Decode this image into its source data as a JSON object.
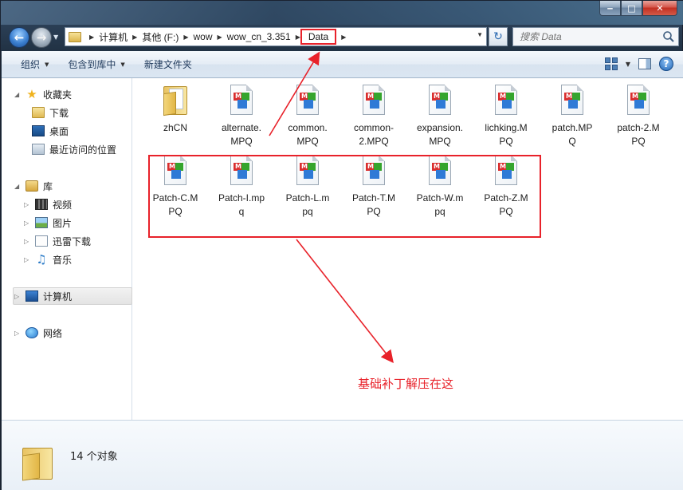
{
  "window": {
    "caption_minimize": "‒",
    "caption_maximize": "□",
    "caption_close": "✕"
  },
  "address_bar": {
    "crumbs": [
      "计算机",
      "其他 (F:)",
      "wow",
      "wow_cn_3.351",
      "Data"
    ],
    "search_placeholder": "搜索 Data"
  },
  "toolbar": {
    "organize": "组织",
    "include_in_library": "包含到库中",
    "new_folder": "新建文件夹"
  },
  "sidebar": {
    "favorites": "收藏夹",
    "favorites_items": [
      "下载",
      "桌面",
      "最近访问的位置"
    ],
    "libraries": "库",
    "library_items": [
      "视频",
      "图片",
      "迅雷下载",
      "音乐"
    ],
    "computer": "计算机",
    "network": "网络"
  },
  "files": [
    {
      "name": "zhCN",
      "type": "folder"
    },
    {
      "name": "alternate.MPQ",
      "type": "mpq"
    },
    {
      "name": "common.MPQ",
      "type": "mpq"
    },
    {
      "name": "common-2.MPQ",
      "type": "mpq"
    },
    {
      "name": "expansion.MPQ",
      "type": "mpq"
    },
    {
      "name": "lichking.MPQ",
      "type": "mpq"
    },
    {
      "name": "patch.MPQ",
      "type": "mpq"
    },
    {
      "name": "patch-2.MPQ",
      "type": "mpq"
    },
    {
      "name": "Patch-C.MPQ",
      "type": "mpq"
    },
    {
      "name": "Patch-I.mpq",
      "type": "mpq"
    },
    {
      "name": "Patch-L.mpq",
      "type": "mpq"
    },
    {
      "name": "Patch-T.MPQ",
      "type": "mpq"
    },
    {
      "name": "Patch-W.mpq",
      "type": "mpq"
    },
    {
      "name": "Patch-Z.MPQ",
      "type": "mpq"
    }
  ],
  "file_labels": {
    "f0": "zhCN",
    "f1": "alternate.\nMPQ",
    "f2": "common.\nMPQ",
    "f3": "common-\n2.MPQ",
    "f4": "expansion.\nMPQ",
    "f5": "lichking.M\nPQ",
    "f6": "patch.MP\nQ",
    "f7": "patch-2.M\nPQ",
    "f8": "Patch-C.M\nPQ",
    "f9": "Patch-I.mp\nq",
    "f10": "Patch-L.m\npq",
    "f11": "Patch-T.M\nPQ",
    "f12": "Patch-W.m\npq",
    "f13": "Patch-Z.M\nPQ"
  },
  "annotation": {
    "note": "基础补丁解压在这",
    "accent_color": "#e8222a"
  },
  "status": {
    "object_count": "14 个对象"
  },
  "icons": {
    "back": "back-arrow-icon",
    "forward": "forward-arrow-icon",
    "refresh": "refresh-icon",
    "search": "search-icon",
    "help": "help-icon"
  }
}
